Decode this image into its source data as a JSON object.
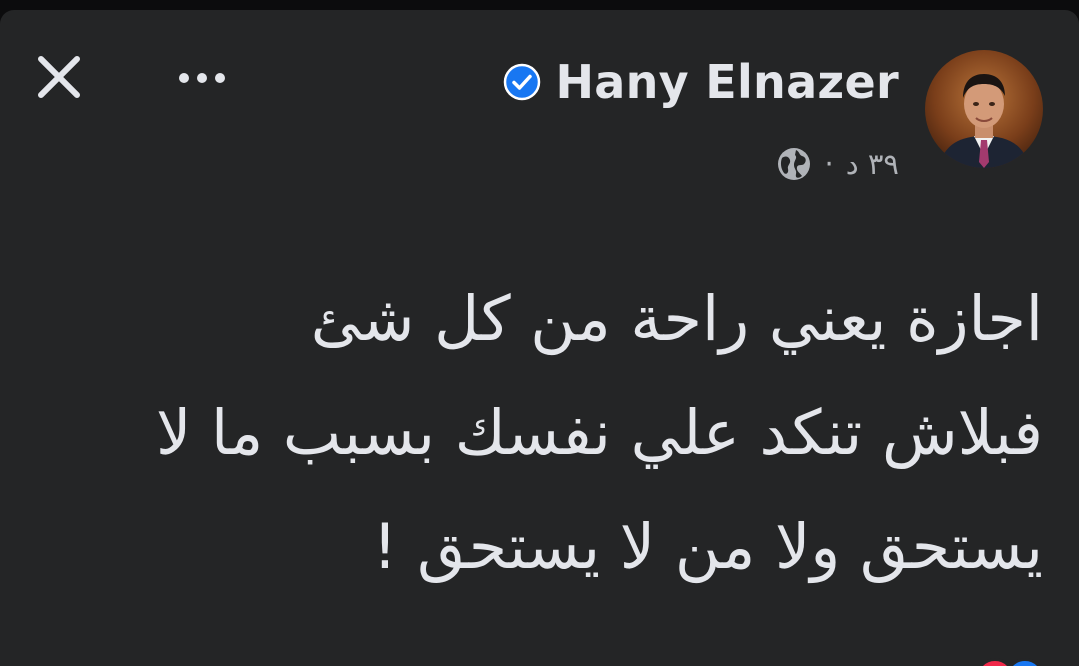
{
  "post": {
    "author_name": "Hany Elnazer",
    "verified": true,
    "timestamp": "٣٩ د",
    "separator": "·",
    "audience_icon": "globe-icon",
    "text": "اجازة يعني راحة من كل شئ\nفبلاش تنكد علي نفسك بسبب ما لا\nيستحق ولا من لا يستحق !",
    "reactions": [
      "love",
      "like"
    ]
  },
  "toolbar": {
    "close_icon": "close-icon",
    "more_icon": "more-options-icon"
  },
  "colors": {
    "card_background": "#242526",
    "text_primary": "#e4e6eb",
    "text_secondary": "#b0b3b8",
    "verified_badge": "#1877f2",
    "love_reaction": "#f02849",
    "like_reaction": "#1877f2"
  }
}
